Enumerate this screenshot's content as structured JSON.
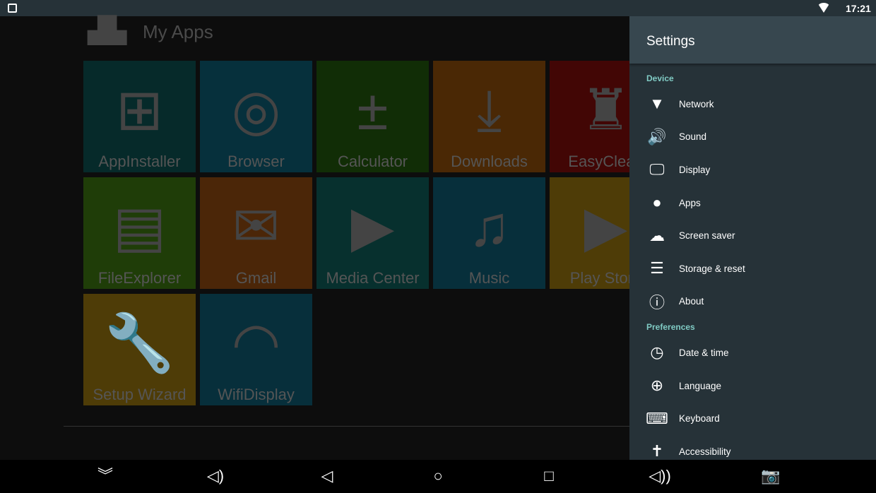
{
  "status_bar": {
    "time": "17:21",
    "icons": [
      "image-icon",
      "wifi-icon"
    ]
  },
  "launcher": {
    "title": "My Apps",
    "apps": [
      {
        "label": "AppInstaller",
        "icon": "app-installer-icon",
        "glyph": "⊞",
        "color": "#062a2a"
      },
      {
        "label": "Browser",
        "icon": "compass-icon",
        "glyph": "◎",
        "color": "#06303c"
      },
      {
        "label": "Calculator",
        "icon": "calculator-icon",
        "glyph": "±",
        "color": "#112d06"
      },
      {
        "label": "Downloads",
        "icon": "download-icon",
        "glyph": "⤓",
        "color": "#4a2805"
      },
      {
        "label": "EasyClean",
        "icon": "broom-icon",
        "glyph": "♜",
        "color": "#420605"
      },
      {
        "label": "FileExplorer",
        "icon": "file-icon",
        "glyph": "▤",
        "color": "#1f3d08"
      },
      {
        "label": "Gmail",
        "icon": "gmail-icon",
        "glyph": "✉",
        "color": "#4b2608"
      },
      {
        "label": "Media Center",
        "icon": "clapperboard-icon",
        "glyph": "▶",
        "color": "#07302e"
      },
      {
        "label": "Music",
        "icon": "music-note-icon",
        "glyph": "♫",
        "color": "#072f3b"
      },
      {
        "label": "Play Store",
        "icon": "play-store-icon",
        "glyph": "▶",
        "color": "#4e3c07"
      },
      {
        "label": "Setup Wizard",
        "icon": "wrench-icon",
        "glyph": "🔧",
        "color": "#4e3c07"
      },
      {
        "label": "WifiDisplay",
        "icon": "wifi-display-icon",
        "glyph": "◠",
        "color": "#072f3b"
      }
    ]
  },
  "settings": {
    "title": "Settings",
    "sections": [
      {
        "label": "Device",
        "items": [
          {
            "label": "Network",
            "icon": "wifi-icon",
            "glyph": "▼"
          },
          {
            "label": "Sound",
            "icon": "speaker-icon",
            "glyph": "🔊"
          },
          {
            "label": "Display",
            "icon": "monitor-icon",
            "glyph": "🖵"
          },
          {
            "label": "Apps",
            "icon": "android-icon",
            "glyph": "●"
          },
          {
            "label": "Screen saver",
            "icon": "screensaver-icon",
            "glyph": "☁"
          },
          {
            "label": "Storage & reset",
            "icon": "storage-icon",
            "glyph": "☰"
          },
          {
            "label": "About",
            "icon": "info-icon",
            "glyph": "ⓘ"
          }
        ]
      },
      {
        "label": "Preferences",
        "items": [
          {
            "label": "Date & time",
            "icon": "clock-icon",
            "glyph": "◷"
          },
          {
            "label": "Language",
            "icon": "globe-icon",
            "glyph": "⊕"
          },
          {
            "label": "Keyboard",
            "icon": "keyboard-icon",
            "glyph": "⌨"
          },
          {
            "label": "Accessibility",
            "icon": "accessibility-icon",
            "glyph": "✝"
          }
        ]
      }
    ]
  },
  "nav_bar": [
    {
      "name": "collapse-button",
      "icon": "double-chevron-down-icon",
      "glyph": "︾"
    },
    {
      "name": "volume-down-button",
      "icon": "volume-down-icon",
      "glyph": "◁)"
    },
    {
      "name": "back-button",
      "icon": "back-icon",
      "glyph": "◁"
    },
    {
      "name": "home-button",
      "icon": "home-icon",
      "glyph": "○"
    },
    {
      "name": "recents-button",
      "icon": "recents-icon",
      "glyph": "□"
    },
    {
      "name": "volume-up-button",
      "icon": "volume-up-icon",
      "glyph": "◁))"
    },
    {
      "name": "screenshot-button",
      "icon": "camera-icon",
      "glyph": "📷"
    }
  ]
}
